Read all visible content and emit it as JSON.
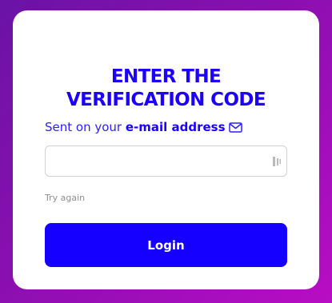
{
  "heading": {
    "line1": "ENTER THE",
    "line2": "VERIFICATION CODE"
  },
  "subtitle": {
    "prefix": "Sent on your ",
    "emphasis": "e-mail address",
    "icon": "mail-icon"
  },
  "code_field": {
    "value": "",
    "placeholder": "",
    "icon": "autofill-key-icon"
  },
  "try_again_label": "Try again",
  "login_label": "Login",
  "colors": {
    "accent": "#1500ff",
    "title": "#1b00ff",
    "background_start": "#6a13a6",
    "background_end": "#b80dc4"
  }
}
